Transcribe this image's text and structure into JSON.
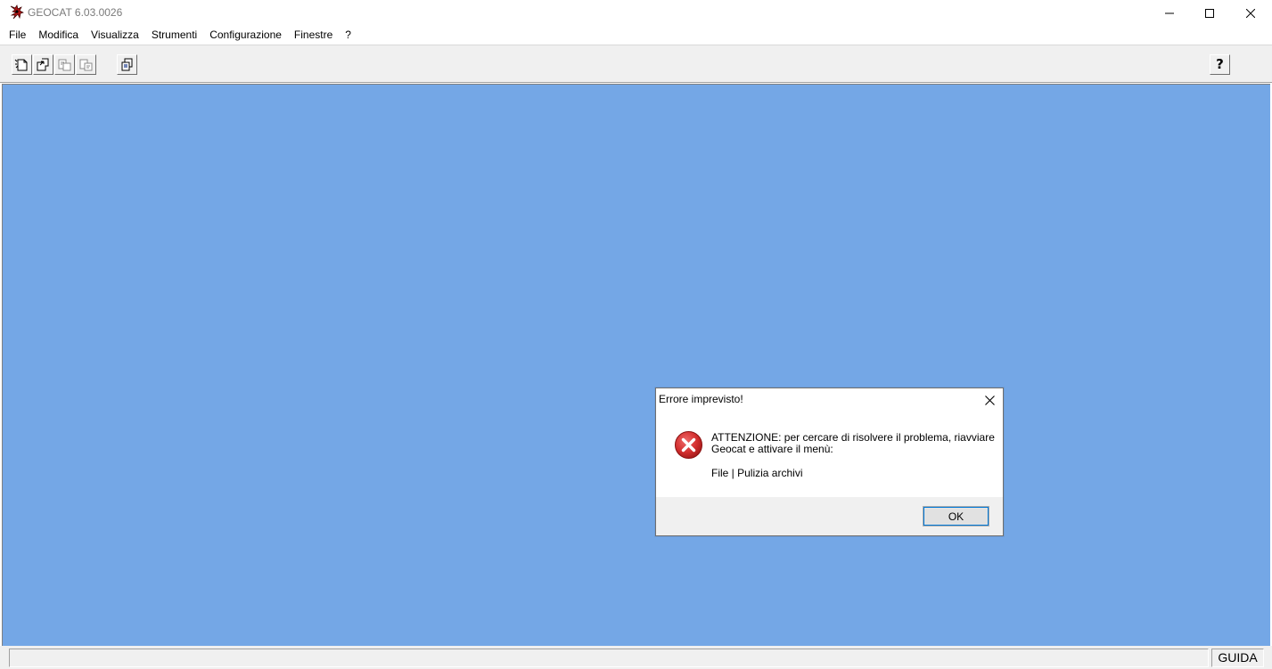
{
  "window": {
    "title": "GEOCAT 6.03.0026"
  },
  "icons": {
    "app": "geocat-app-icon",
    "minimize": "minimize-icon",
    "maximize": "maximize-icon",
    "close": "close-icon",
    "toolbar": [
      "new-document-icon",
      "open-document-icon",
      "export-icon",
      "import-icon",
      "copy-icon",
      "help-icon"
    ],
    "dialog_error": "error-icon"
  },
  "menu": {
    "items": [
      "File",
      "Modifica",
      "Visualizza",
      "Strumenti",
      "Configurazione",
      "Finestre",
      "?"
    ]
  },
  "toolbar": {
    "help_label": "?"
  },
  "colors": {
    "workspace": "#74a7e6",
    "error_red": "#d32f2f",
    "focus_blue": "#0078d7"
  },
  "statusbar": {
    "left_text": "",
    "guida": "GUIDA"
  },
  "dialog": {
    "title": "Errore imprevisto!",
    "message": "ATTENZIONE: per cercare di risolvere il problema, riavviare\nGeocat e attivare il menù:",
    "path": "File | Pulizia archivi",
    "ok_label": "OK"
  }
}
